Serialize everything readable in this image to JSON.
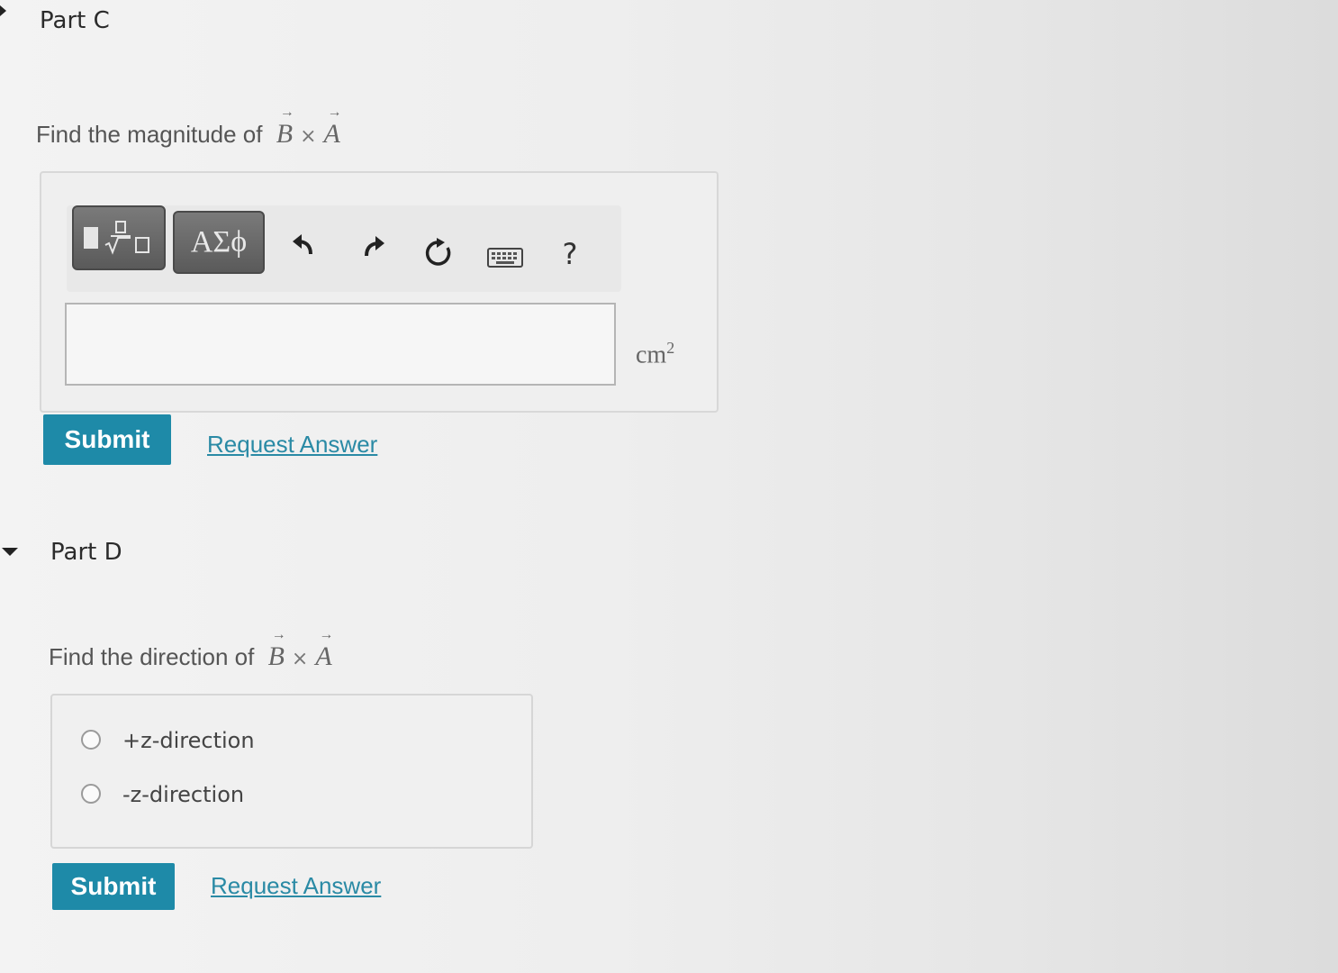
{
  "partC": {
    "title": "Part C",
    "question_text": "Find the magnitude of",
    "math": {
      "left": "B",
      "op": "×",
      "right": "A"
    },
    "toolbar": {
      "templates_icon": "fraction-sqrt-icon",
      "greek_label": "ΑΣϕ",
      "undo_icon": "undo-icon",
      "redo_icon": "redo-icon",
      "reset_icon": "reset-icon",
      "keyboard_icon": "keyboard-icon",
      "help_label": "?"
    },
    "answer_value": "",
    "unit": "cm",
    "unit_exponent": "2",
    "submit_label": "Submit",
    "request_label": "Request Answer"
  },
  "partD": {
    "title": "Part D",
    "question_text": "Find the direction of",
    "math": {
      "left": "B",
      "op": "×",
      "right": "A"
    },
    "options": [
      "+z-direction",
      "-z-direction"
    ],
    "submit_label": "Submit",
    "request_label": "Request Answer"
  },
  "colors": {
    "accent": "#1e8aa8",
    "link": "#2a8aa5",
    "tool_button": "#6a6a6a"
  }
}
